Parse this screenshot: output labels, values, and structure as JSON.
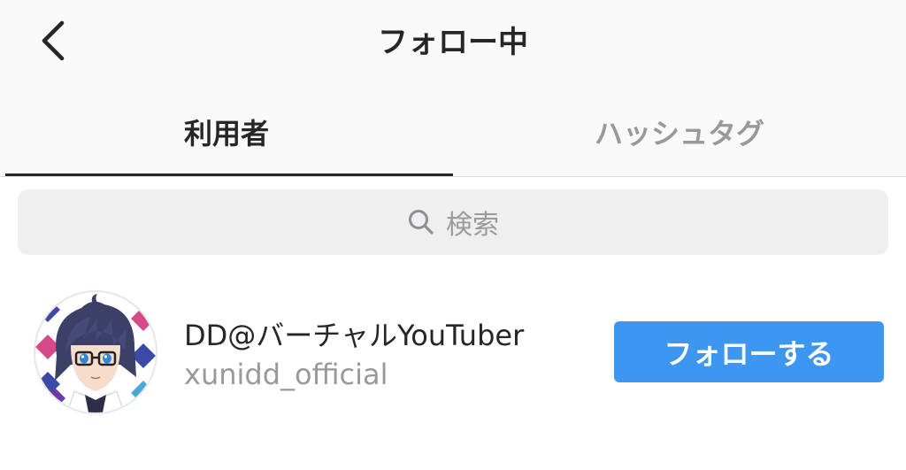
{
  "header": {
    "title": "フォロー中",
    "back_icon": "chevron-left-icon"
  },
  "tabs": [
    {
      "label": "利用者",
      "active": true
    },
    {
      "label": "ハッシュタグ",
      "active": false
    }
  ],
  "search": {
    "placeholder": "検索",
    "icon": "search-icon"
  },
  "users": [
    {
      "display_name": "DD@バーチャルYouTuber",
      "handle": "xunidd_official",
      "follow_label": "フォローする"
    }
  ],
  "colors": {
    "header_bg": "#f9f9f9",
    "accent": "#3d97f0",
    "text_primary": "#262626",
    "text_secondary": "#999999",
    "search_bg": "#efeff0"
  }
}
